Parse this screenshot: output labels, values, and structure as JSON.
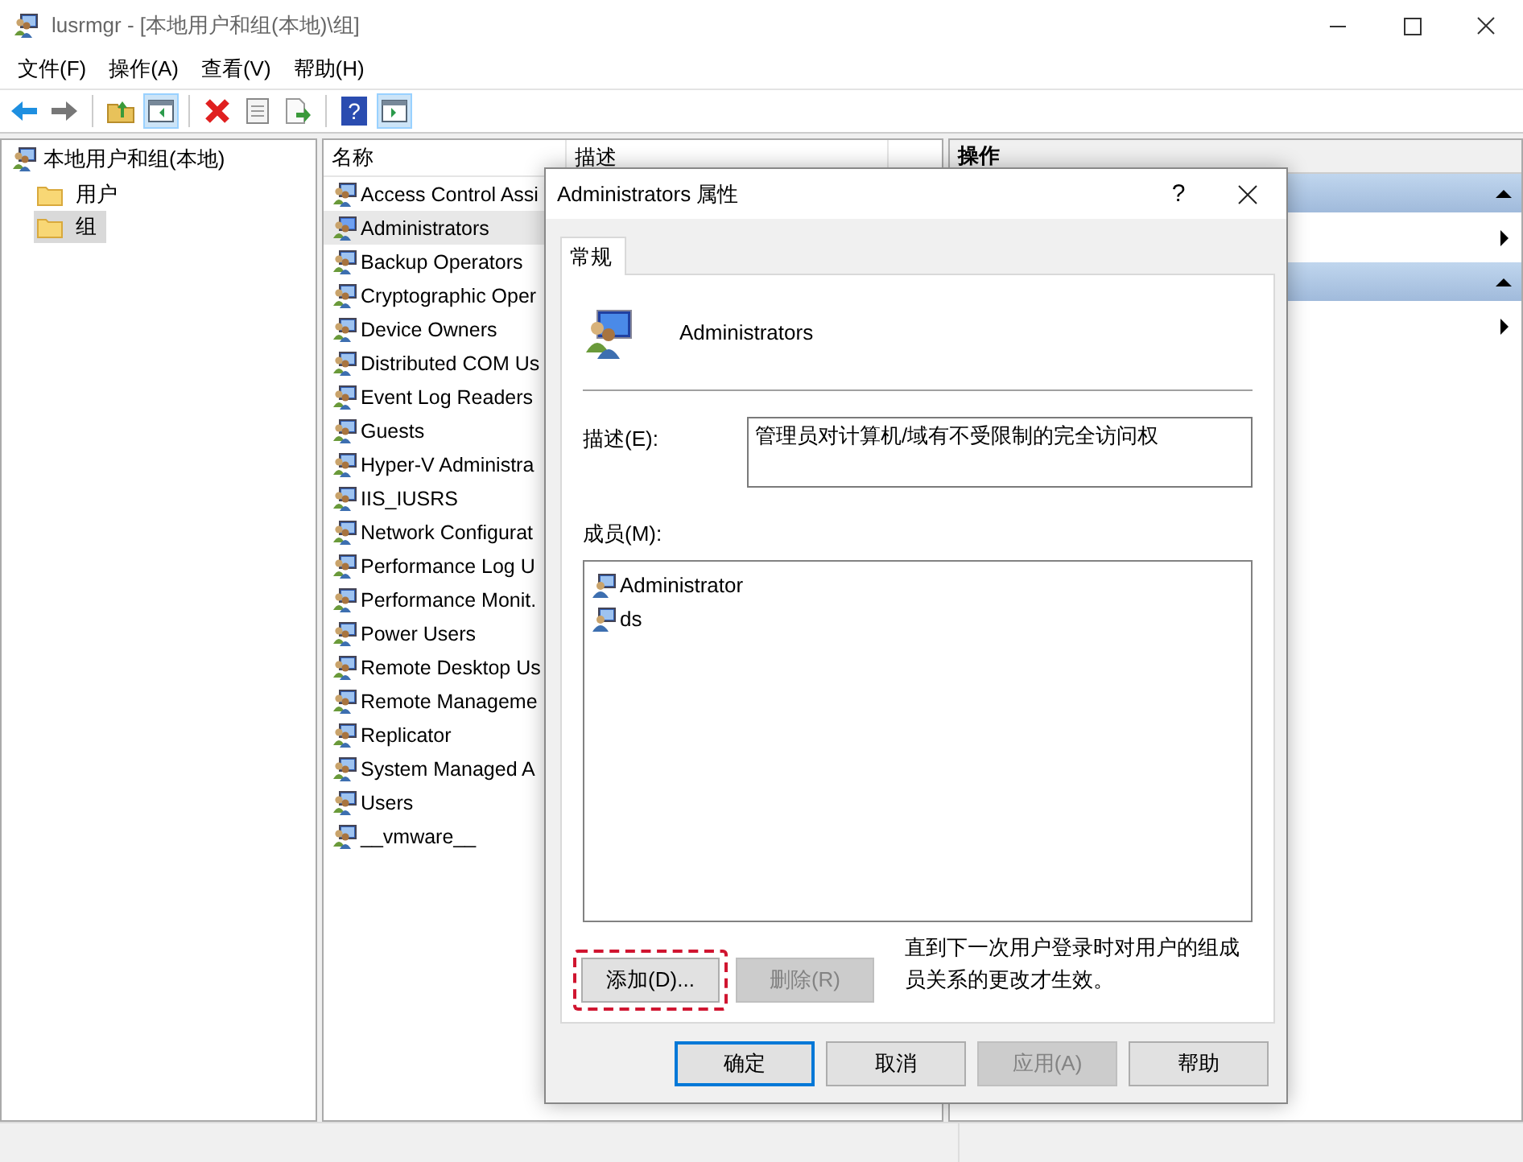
{
  "window": {
    "title": "lusrmgr - [本地用户和组(本地)\\组]"
  },
  "menu": [
    "文件(F)",
    "操作(A)",
    "查看(V)",
    "帮助(H)"
  ],
  "toolbar": {
    "help_glyph": "?"
  },
  "tree": {
    "label": "本地用户和组(本地)",
    "children": [
      {
        "label": "用户",
        "selected": false
      },
      {
        "label": "组",
        "selected": true
      }
    ]
  },
  "list": {
    "columns": [
      "名称",
      "描述"
    ],
    "rows": [
      {
        "name": "Access Control Assi",
        "selected": false
      },
      {
        "name": "Administrators",
        "selected": true
      },
      {
        "name": "Backup Operators",
        "selected": false
      },
      {
        "name": "Cryptographic Oper",
        "selected": false
      },
      {
        "name": "Device Owners",
        "selected": false
      },
      {
        "name": "Distributed COM Us",
        "selected": false
      },
      {
        "name": "Event Log Readers",
        "selected": false
      },
      {
        "name": "Guests",
        "selected": false
      },
      {
        "name": "Hyper-V Administra",
        "selected": false
      },
      {
        "name": "IIS_IUSRS",
        "selected": false
      },
      {
        "name": "Network Configurat",
        "selected": false
      },
      {
        "name": "Performance Log U",
        "selected": false
      },
      {
        "name": "Performance Monit.",
        "selected": false
      },
      {
        "name": "Power Users",
        "selected": false
      },
      {
        "name": "Remote Desktop Us",
        "selected": false
      },
      {
        "name": "Remote Manageme",
        "selected": false
      },
      {
        "name": "Replicator",
        "selected": false
      },
      {
        "name": "System Managed A",
        "selected": false
      },
      {
        "name": "Users",
        "selected": false
      },
      {
        "name": "__vmware__",
        "selected": false
      }
    ]
  },
  "actions": {
    "title": "操作",
    "sections": [
      {
        "expanded": true
      },
      {
        "expanded": true
      }
    ]
  },
  "dialog": {
    "title": "Administrators 属性",
    "help": "?",
    "tabs": [
      {
        "label": "常规",
        "selected": true
      }
    ],
    "group_name": "Administrators",
    "description_label": "描述(E):",
    "description": "管理员对计算机/域有不受限制的完全访问权",
    "members_label": "成员(M):",
    "members": [
      "Administrator",
      "ds"
    ],
    "add_button": {
      "label": "添加(D)...",
      "highlighted": true,
      "disabled": false
    },
    "remove_button": {
      "label": "删除(R)",
      "highlighted": false,
      "disabled": true
    },
    "note": "直到下一次用户登录时对用户的组成员关系的更改才生效。",
    "buttons": [
      {
        "label": "确定",
        "default": true,
        "disabled": false
      },
      {
        "label": "取消",
        "default": false,
        "disabled": false
      },
      {
        "label": "应用(A)",
        "default": false,
        "disabled": true
      },
      {
        "label": "帮助",
        "default": false,
        "disabled": false
      }
    ]
  }
}
